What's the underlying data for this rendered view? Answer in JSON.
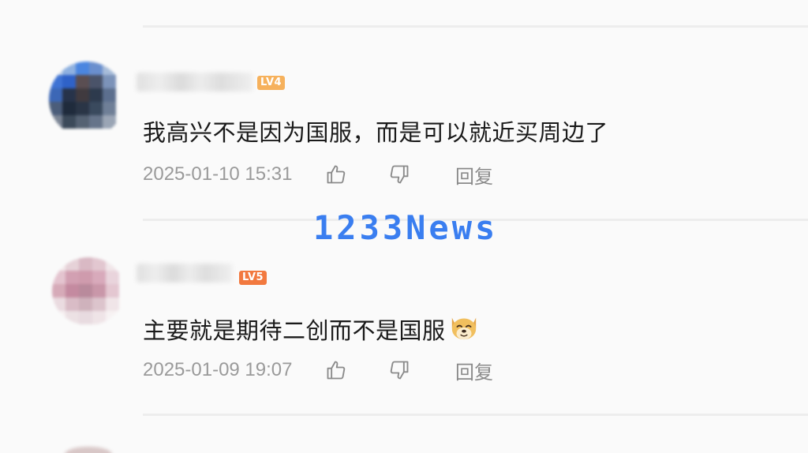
{
  "comments": [
    {
      "username": "●●●●●●●●●",
      "level": "LV4",
      "text": "我高兴不是因为国服，而是可以就近买周边了",
      "timestamp": "2025-01-10 15:31",
      "reply_label": "回复"
    },
    {
      "username": "●●●●●●●",
      "level": "LV5",
      "text": "主要就是期待二创而不是国服",
      "timestamp": "2025-01-09 19:07",
      "reply_label": "回复"
    }
  ],
  "watermark": {
    "text": "1233News"
  },
  "icons": {
    "like": "thumbs-up-icon",
    "dislike": "thumbs-down-icon",
    "emoji": "doge-emoji-icon"
  },
  "colors": {
    "badge_lv4": "#f6b15c",
    "badge_lv5": "#f2793f",
    "watermark": "#3a7ef0",
    "timestamp": "#9a9a9a",
    "comment_text": "#1a1a1a"
  }
}
